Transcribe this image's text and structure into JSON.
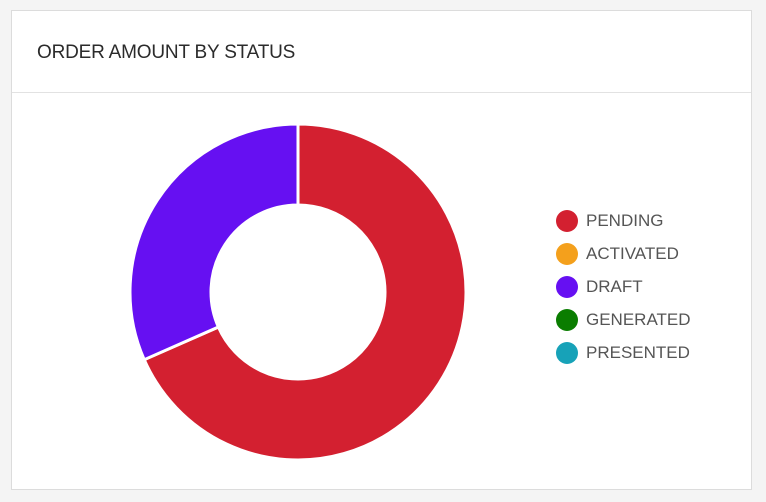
{
  "card": {
    "title": "ORDER AMOUNT BY STATUS"
  },
  "chart_data": {
    "type": "pie",
    "variant": "donut",
    "title": "ORDER AMOUNT BY STATUS",
    "categories": [
      "PENDING",
      "ACTIVATED",
      "DRAFT",
      "GENERATED",
      "PRESENTED"
    ],
    "values": [
      68.4,
      0,
      31.6,
      0,
      0
    ],
    "value_unit": "percent",
    "colors": [
      "#d32030",
      "#f4a01c",
      "#6610f2",
      "#0a7d00",
      "#17a2b8"
    ],
    "legend": {
      "placement": "right",
      "entries": [
        "PENDING",
        "ACTIVATED",
        "DRAFT",
        "GENERATED",
        "PRESENTED"
      ]
    }
  }
}
